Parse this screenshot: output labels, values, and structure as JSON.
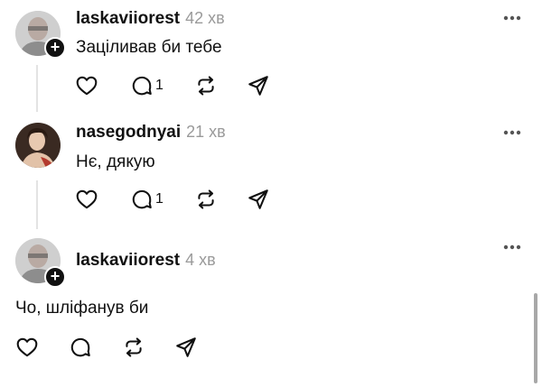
{
  "posts": [
    {
      "username": "laskaviiorest",
      "time": "42 хв",
      "text": "Заціливав би тебе",
      "reply_count": "1",
      "avatar": "avatar-gray",
      "has_follow": true
    },
    {
      "username": "nasegodnyai",
      "time": "21 хв",
      "text": "Нє, дякую",
      "reply_count": "1",
      "avatar": "avatar-painting",
      "has_follow": false
    },
    {
      "username": "laskaviiorest",
      "time": "4 хв",
      "text": "Чо, шліфанув би",
      "reply_count": "",
      "avatar": "avatar-gray",
      "has_follow": true
    }
  ],
  "follow_symbol": "+",
  "icons": {
    "like": "heart-icon",
    "reply": "comment-icon",
    "repost": "repost-icon",
    "share": "share-icon",
    "more": "more-icon"
  }
}
